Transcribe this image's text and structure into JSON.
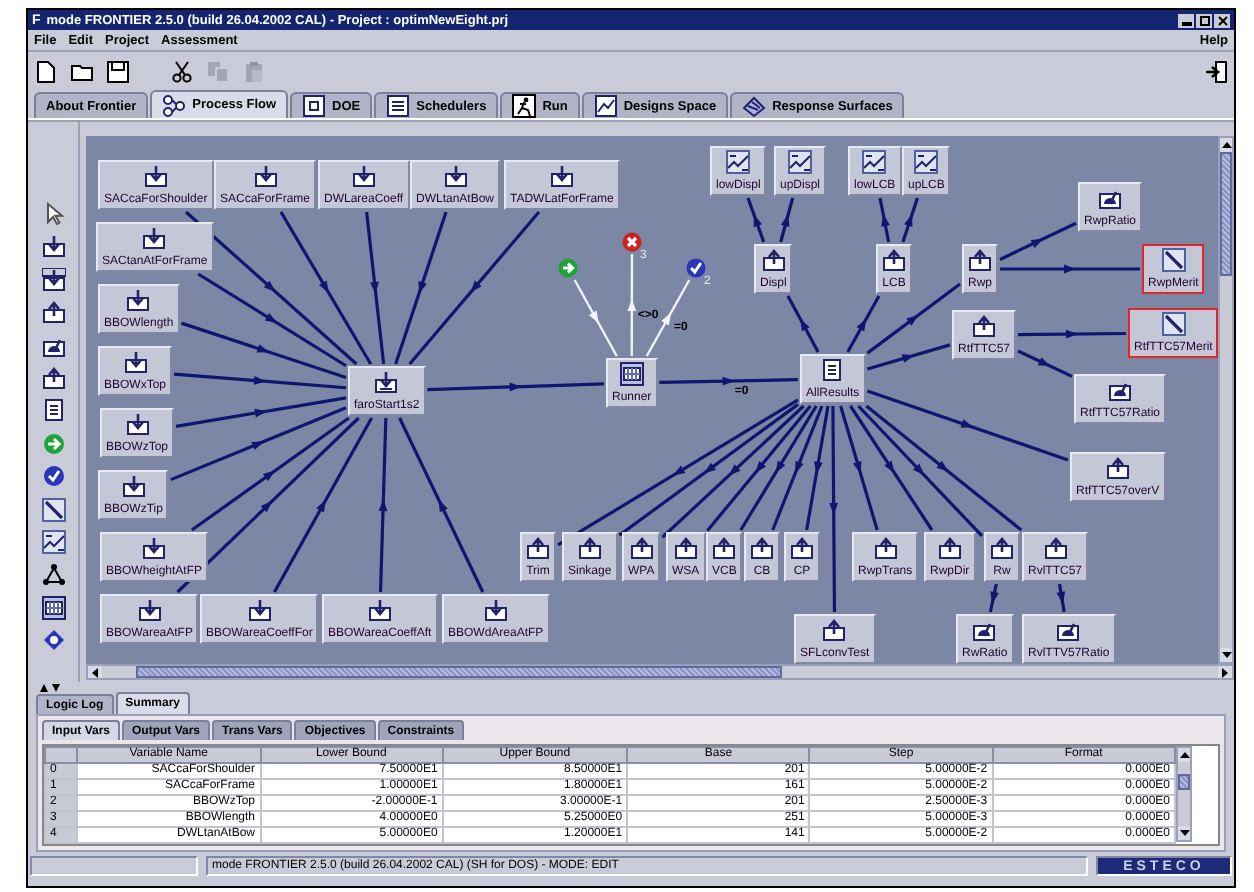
{
  "window": {
    "app_icon": "F",
    "title": "mode FRONTIER 2.5.0 (build 26.04.2002 CAL) - Project : optimNewEight.prj"
  },
  "menu": [
    {
      "label": "File"
    },
    {
      "label": "Edit"
    },
    {
      "label": "Project"
    },
    {
      "label": "Assessment"
    }
  ],
  "help_menu": "Help",
  "toolbar": [
    {
      "kind": "new",
      "disabled": false
    },
    {
      "kind": "open",
      "disabled": false
    },
    {
      "kind": "save",
      "disabled": false
    },
    {
      "kind": "cut",
      "disabled": false
    },
    {
      "kind": "copy",
      "disabled": true
    },
    {
      "kind": "paste",
      "disabled": true
    }
  ],
  "tabs": [
    {
      "label": "About Frontier",
      "selected": false
    },
    {
      "label": "Process Flow",
      "selected": true
    },
    {
      "label": "DOE",
      "selected": false
    },
    {
      "label": "Schedulers",
      "selected": false
    },
    {
      "label": "Run",
      "selected": false
    },
    {
      "label": "Designs Space",
      "selected": false
    },
    {
      "label": "Response Surfaces",
      "selected": false
    }
  ],
  "flow": {
    "nodes": [
      {
        "label": "SACcaForShoulder",
        "kind": "input",
        "selected": false
      },
      {
        "label": "SACcaForFrame",
        "kind": "input",
        "selected": false
      },
      {
        "label": "DWLareaCoeff",
        "kind": "input",
        "selected": false
      },
      {
        "label": "DWLtanAtBow",
        "kind": "input",
        "selected": false
      },
      {
        "label": "TADWLatForFrame",
        "kind": "input",
        "selected": false
      },
      {
        "label": "SACtanAtForFrame",
        "kind": "input",
        "selected": false
      },
      {
        "label": "BBOWlength",
        "kind": "input",
        "selected": false
      },
      {
        "label": "BBOWxTop",
        "kind": "input",
        "selected": false
      },
      {
        "label": "BBOWzTop",
        "kind": "input",
        "selected": false
      },
      {
        "label": "BBOWzTip",
        "kind": "input",
        "selected": false
      },
      {
        "label": "BBOWheightAtFP",
        "kind": "input",
        "selected": false
      },
      {
        "label": "BBOWareaAtFP",
        "kind": "input",
        "selected": false
      },
      {
        "label": "BBOWareaCoeffFor",
        "kind": "input",
        "selected": false
      },
      {
        "label": "BBOWareaCoeffAft",
        "kind": "input",
        "selected": false
      },
      {
        "label": "BBOWdAreaAtFP",
        "kind": "input",
        "selected": false
      },
      {
        "label": "faroStart1s2",
        "kind": "script",
        "selected": false
      },
      {
        "label": "3",
        "kind": "fail",
        "selected": false
      },
      {
        "kind": "start",
        "selected": false
      },
      {
        "label": "2",
        "kind": "success",
        "selected": false
      },
      {
        "label": "Runner",
        "kind": "runner",
        "selected": false
      },
      {
        "label": "AllResults",
        "kind": "results",
        "selected": false
      },
      {
        "label": "lowDispl",
        "kind": "constraint",
        "selected": false
      },
      {
        "label": "upDispl",
        "kind": "constraint",
        "selected": false
      },
      {
        "label": "lowLCB",
        "kind": "constraint",
        "selected": false
      },
      {
        "label": "upLCB",
        "kind": "constraint",
        "selected": false
      },
      {
        "label": "Displ",
        "kind": "output",
        "selected": false
      },
      {
        "label": "LCB",
        "kind": "output",
        "selected": false
      },
      {
        "label": "Rwp",
        "kind": "output",
        "selected": false
      },
      {
        "label": "RwpRatio",
        "kind": "ratio",
        "selected": false
      },
      {
        "label": "RwpMerit",
        "kind": "objective",
        "selected": true
      },
      {
        "label": "RtfTTC57",
        "kind": "output",
        "selected": false
      },
      {
        "label": "RtfTTC57Merit",
        "kind": "objective",
        "selected": true
      },
      {
        "label": "RtfTTC57Ratio",
        "kind": "ratio",
        "selected": false
      },
      {
        "label": "RtfTTC57overV",
        "kind": "output",
        "selected": false
      },
      {
        "label": "Trim",
        "kind": "output",
        "selected": false
      },
      {
        "label": "Sinkage",
        "kind": "output",
        "selected": false
      },
      {
        "label": "WPA",
        "kind": "output",
        "selected": false
      },
      {
        "label": "WSA",
        "kind": "output",
        "selected": false
      },
      {
        "label": "VCB",
        "kind": "output",
        "selected": false
      },
      {
        "label": "CB",
        "kind": "output",
        "selected": false
      },
      {
        "label": "CP",
        "kind": "output",
        "selected": false
      },
      {
        "label": "RwpTrans",
        "kind": "output",
        "selected": false
      },
      {
        "label": "RwpDir",
        "kind": "output",
        "selected": false
      },
      {
        "label": "Rw",
        "kind": "output",
        "selected": false
      },
      {
        "label": "RvlTTC57",
        "kind": "output",
        "selected": false
      },
      {
        "label": "SFLconvTest",
        "kind": "output",
        "selected": false
      },
      {
        "label": "RwRatio",
        "kind": "ratio",
        "selected": false
      },
      {
        "label": "RvlTTV57Ratio",
        "kind": "ratio",
        "selected": false
      }
    ],
    "edge_labels": [
      "<>0",
      "=0",
      "=0"
    ]
  },
  "log_tabs": [
    {
      "label": "Logic Log",
      "selected": false
    },
    {
      "label": "Summary",
      "selected": true
    }
  ],
  "var_tabs": [
    {
      "label": "Input Vars",
      "selected": true
    },
    {
      "label": "Output Vars",
      "selected": false
    },
    {
      "label": "Trans Vars",
      "selected": false
    },
    {
      "label": "Objectives",
      "selected": false
    },
    {
      "label": "Constraints",
      "selected": false
    }
  ],
  "table": {
    "columns": [
      "",
      "Variable Name",
      "Lower Bound",
      "Upper Bound",
      "Base",
      "Step",
      "Format"
    ],
    "rows": [
      [
        "0",
        "SACcaForShoulder",
        "7.50000E1",
        "8.50000E1",
        "201",
        "5.00000E-2",
        "0.000E0"
      ],
      [
        "1",
        "SACcaForFrame",
        "1.00000E1",
        "1.80000E1",
        "161",
        "5.00000E-2",
        "0.000E0"
      ],
      [
        "2",
        "BBOWzTop",
        "-2.00000E-1",
        "3.00000E-1",
        "201",
        "2.50000E-3",
        "0.000E0"
      ],
      [
        "3",
        "BBOWlength",
        "4.00000E0",
        "5.25000E0",
        "251",
        "5.00000E-3",
        "0.000E0"
      ],
      [
        "4",
        "DWLtanAtBow",
        "5.00000E0",
        "1.20000E1",
        "141",
        "5.00000E-2",
        "0.000E0"
      ]
    ]
  },
  "status_bar": {
    "message": "mode FRONTIER 2.5.0 (build 26.04.2002 CAL) (SH for DOS) - MODE: EDIT",
    "logo": "ESTECO"
  }
}
